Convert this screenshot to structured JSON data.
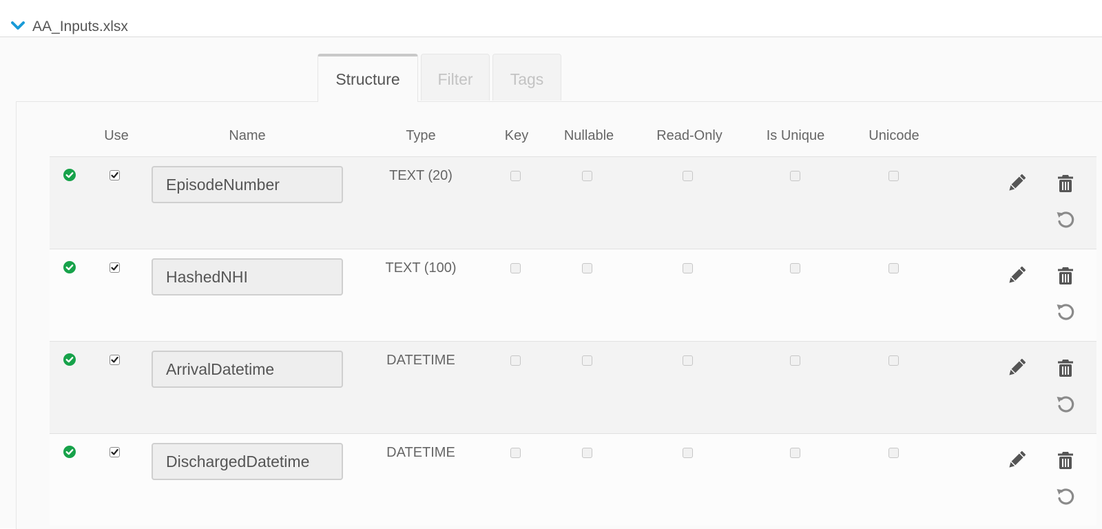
{
  "file": {
    "title": "AA_Inputs.xlsx"
  },
  "tabs": [
    {
      "label": "Structure",
      "active": true
    },
    {
      "label": "Filter",
      "active": false
    },
    {
      "label": "Tags",
      "active": false
    }
  ],
  "columns": {
    "use": "Use",
    "name": "Name",
    "type": "Type",
    "key": "Key",
    "nullable": "Nullable",
    "read_only": "Read-Only",
    "is_unique": "Is Unique",
    "unicode": "Unicode"
  },
  "rows": [
    {
      "name": "EpisodeNumber",
      "type": "TEXT (20)",
      "use": true,
      "key": false,
      "nullable": false,
      "read_only": false,
      "is_unique": false,
      "unicode": false
    },
    {
      "name": "HashedNHI",
      "type": "TEXT (100)",
      "use": true,
      "key": false,
      "nullable": false,
      "read_only": false,
      "is_unique": false,
      "unicode": false
    },
    {
      "name": "ArrivalDatetime",
      "type": "DATETIME",
      "use": true,
      "key": false,
      "nullable": false,
      "read_only": false,
      "is_unique": false,
      "unicode": false
    },
    {
      "name": "DischargedDatetime",
      "type": "DATETIME",
      "use": true,
      "key": false,
      "nullable": false,
      "read_only": false,
      "is_unique": false,
      "unicode": false
    }
  ],
  "icons": {
    "expand": "chevron-down-icon",
    "status": "check-circle-icon",
    "edit": "pencil-icon",
    "delete": "trash-icon",
    "reset": "undo-icon"
  },
  "colors": {
    "accent": "#1a9bd7",
    "valid": "#17a24a",
    "icon": "#555555"
  }
}
